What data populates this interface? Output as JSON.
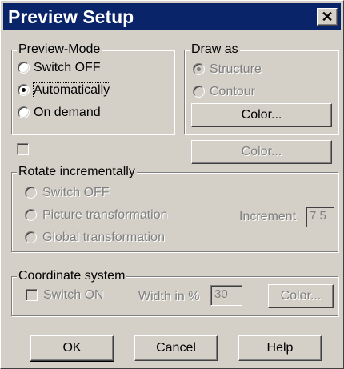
{
  "window": {
    "title": "Preview Setup",
    "close_glyph": "✕"
  },
  "preview_mode": {
    "label": "Preview-Mode",
    "options": [
      "Switch OFF",
      "Automatically",
      "On demand"
    ],
    "selected": "Automatically"
  },
  "draw_as": {
    "label": "Draw as",
    "options": [
      "Structure",
      "Contour"
    ],
    "selected": "Structure",
    "color_button": "Color..."
  },
  "standalone": {
    "checkbox_checked": false,
    "color_button": "Color..."
  },
  "rotate": {
    "label": "Rotate incrementally",
    "options": [
      "Switch OFF",
      "Picture transformation",
      "Global transformation"
    ],
    "increment_label": "Increment",
    "increment_value": "7.5"
  },
  "coordinate_system": {
    "label": "Coordinate system",
    "switch_label": "Switch ON",
    "switch_checked": false,
    "width_label": "Width in %",
    "width_value": "30",
    "color_button": "Color..."
  },
  "footer": {
    "ok": "OK",
    "cancel": "Cancel",
    "help": "Help"
  }
}
